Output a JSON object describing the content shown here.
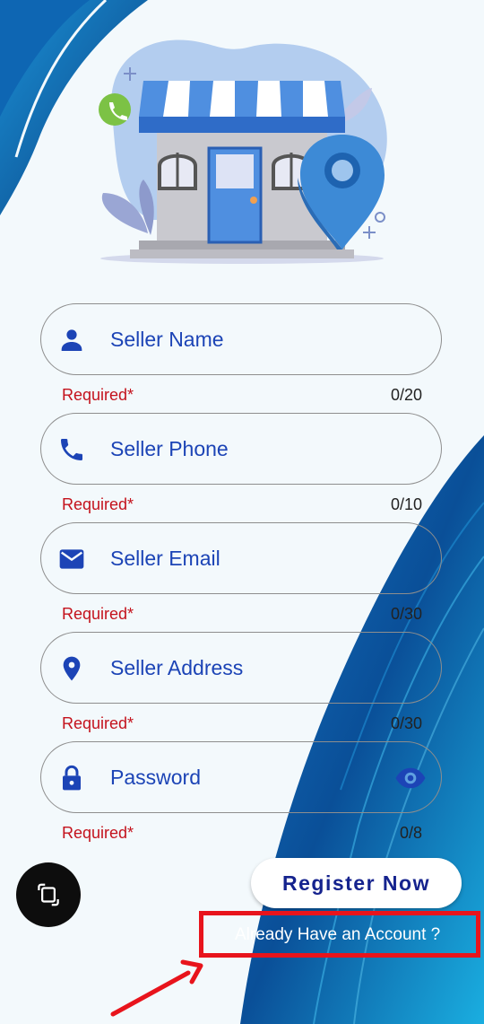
{
  "colors": {
    "primary": "#1c44b6",
    "required": "#c4121c",
    "button_text": "#15238e",
    "annotation": "#e8141c"
  },
  "fields": [
    {
      "label": "Seller Name",
      "icon": "person-icon",
      "helper": "Required*",
      "counter": "0/20"
    },
    {
      "label": "Seller Phone",
      "icon": "phone-icon",
      "helper": "Required*",
      "counter": "0/10"
    },
    {
      "label": "Seller Email",
      "icon": "email-icon",
      "helper": "Required*",
      "counter": "0/30"
    },
    {
      "label": "Seller Address",
      "icon": "location-pin-icon",
      "helper": "Required*",
      "counter": "0/30"
    },
    {
      "label": "Password",
      "icon": "lock-icon",
      "trailing_icon": "eye-icon",
      "helper": "Required*",
      "counter": "0/8"
    }
  ],
  "register_button": {
    "label": "Register Now"
  },
  "login_link": {
    "label": "Already Have an Account ?"
  }
}
